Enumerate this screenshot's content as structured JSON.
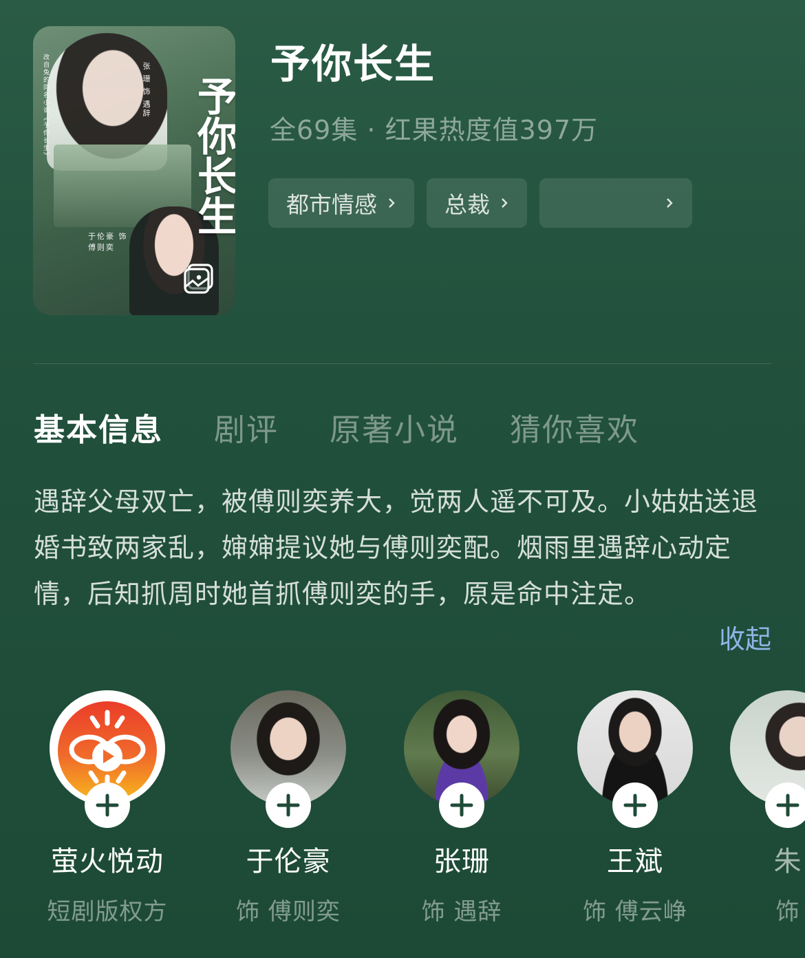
{
  "drama": {
    "title": "予你长生",
    "meta": "全69集 · 红果热度值397万",
    "poster_title": "予你长生",
    "poster_credits": {
      "top": "张 珊 饰 遇辞",
      "bottom": "于伦豪 饰 傅则奕",
      "side": "改自兔的同名小说《予你长生》"
    }
  },
  "tags": [
    {
      "label": "都市情感"
    },
    {
      "label": "总裁"
    },
    {
      "label": ""
    }
  ],
  "tabs": [
    {
      "label": "基本信息",
      "active": true
    },
    {
      "label": "剧评",
      "active": false
    },
    {
      "label": "原著小说",
      "active": false
    },
    {
      "label": "猜你喜欢",
      "active": false
    }
  ],
  "synopsis": {
    "text": "遇辞父母双亡，被傅则奕养大，觉两人遥不可及。小姑姑送退婚书致两家乱，婶婶提议她与傅则奕配。烟雨里遇辞心动定情，后知抓周时她首抓傅则奕的手，原是命中注定。",
    "collapse_label": "收起"
  },
  "cast": [
    {
      "name": "萤火悦动",
      "role": "短剧版权方",
      "avatar": "firefly-logo"
    },
    {
      "name": "于伦豪",
      "role": "饰  傅则奕",
      "avatar": "actor-photo"
    },
    {
      "name": "张珊",
      "role": "饰  遇辞",
      "avatar": "actress-photo"
    },
    {
      "name": "王斌",
      "role": "饰  傅云峥",
      "avatar": "actor-photo"
    },
    {
      "name": "朱",
      "role": "饰",
      "avatar": "actress-photo"
    }
  ],
  "colors": {
    "background": "#21503c",
    "link": "#8fb5e8",
    "logo_orange": "#f06a2a",
    "logo_yellow": "#f7b51e"
  }
}
